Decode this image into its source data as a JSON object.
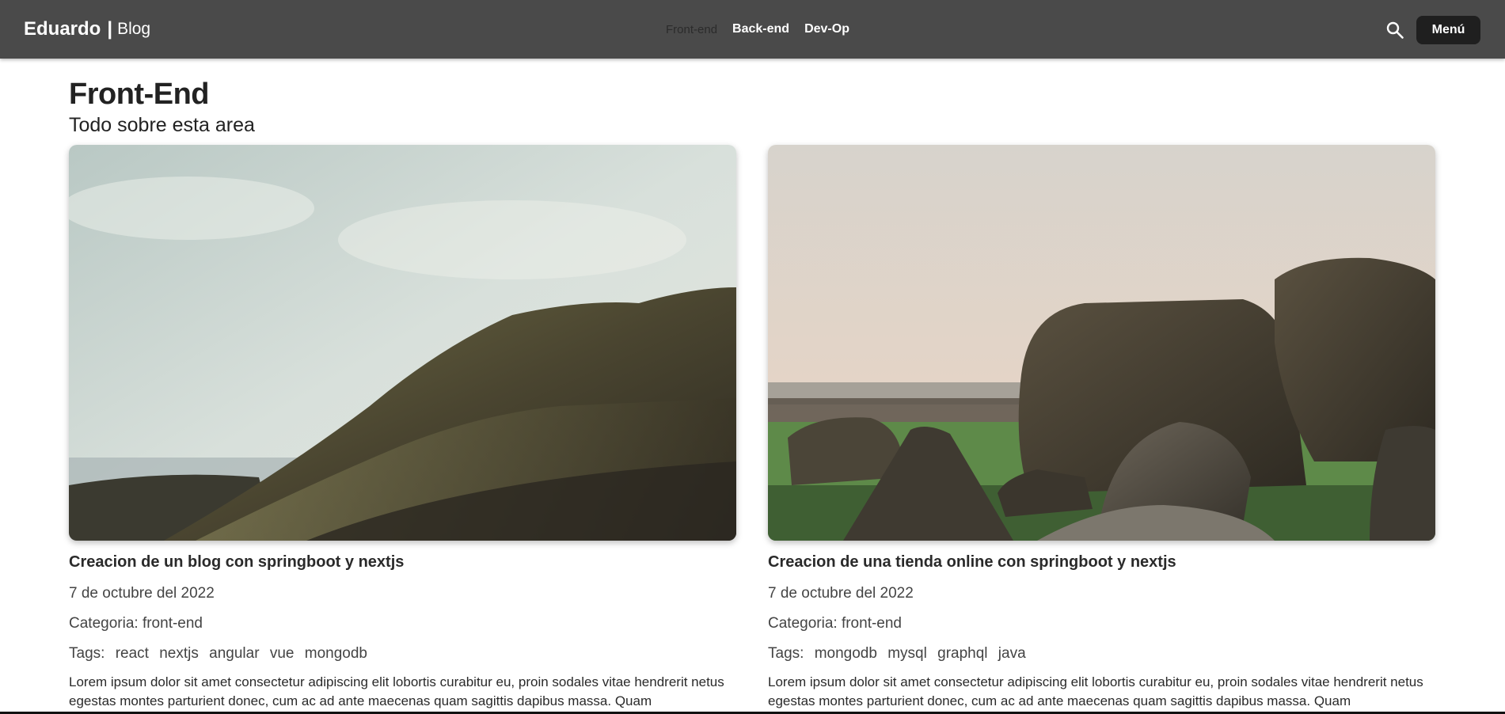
{
  "header": {
    "brand_name": "Eduardo",
    "brand_separator": "|",
    "brand_sub": "Blog",
    "nav": [
      {
        "label": "Front-end",
        "active": true
      },
      {
        "label": "Back-end",
        "active": false
      },
      {
        "label": "Dev-Op",
        "active": false
      }
    ],
    "search_icon": "search-icon",
    "menu_label": "Menú"
  },
  "page": {
    "title": "Front-End",
    "subtitle": "Todo sobre esta area"
  },
  "posts": [
    {
      "image": "hillside-landscape",
      "title": "Creacion de un blog con springboot y nextjs",
      "date": "7 de octubre del 2022",
      "category_label": "Categoria:",
      "category": "front-end",
      "tags_label": "Tags:",
      "tags": [
        "react",
        "nextjs",
        "angular",
        "vue",
        "mongodb"
      ],
      "excerpt": "Lorem ipsum dolor sit amet consectetur adipiscing elit lobortis curabitur eu, proin sodales vitae hendrerit netus egestas montes parturient donec, cum ac ad ante maecenas quam sagittis dapibus massa. Quam"
    },
    {
      "image": "stone-boulders-field",
      "title": "Creacion de una tienda online con springboot y nextjs",
      "date": "7 de octubre del 2022",
      "category_label": "Categoria:",
      "category": "front-end",
      "tags_label": "Tags:",
      "tags": [
        "mongodb",
        "mysql",
        "graphql",
        "java"
      ],
      "excerpt": "Lorem ipsum dolor sit amet consectetur adipiscing elit lobortis curabitur eu, proin sodales vitae hendrerit netus egestas montes parturient donec, cum ac ad ante maecenas quam sagittis dapibus massa. Quam"
    }
  ],
  "colors": {
    "navbar": "#4a4a4a",
    "menu_button": "#1f1f1f",
    "text": "#212121"
  }
}
